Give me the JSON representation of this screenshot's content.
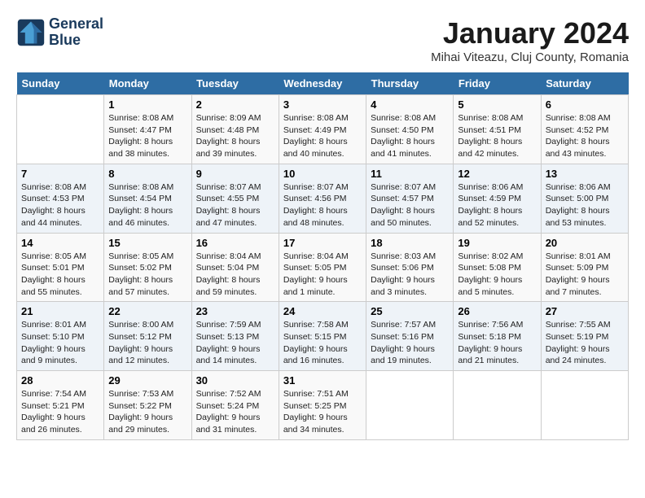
{
  "logo": {
    "line1": "General",
    "line2": "Blue"
  },
  "title": "January 2024",
  "location": "Mihai Viteazu, Cluj County, Romania",
  "weekdays": [
    "Sunday",
    "Monday",
    "Tuesday",
    "Wednesday",
    "Thursday",
    "Friday",
    "Saturday"
  ],
  "weeks": [
    [
      {
        "day": "",
        "info": ""
      },
      {
        "day": "1",
        "info": "Sunrise: 8:08 AM\nSunset: 4:47 PM\nDaylight: 8 hours\nand 38 minutes."
      },
      {
        "day": "2",
        "info": "Sunrise: 8:09 AM\nSunset: 4:48 PM\nDaylight: 8 hours\nand 39 minutes."
      },
      {
        "day": "3",
        "info": "Sunrise: 8:08 AM\nSunset: 4:49 PM\nDaylight: 8 hours\nand 40 minutes."
      },
      {
        "day": "4",
        "info": "Sunrise: 8:08 AM\nSunset: 4:50 PM\nDaylight: 8 hours\nand 41 minutes."
      },
      {
        "day": "5",
        "info": "Sunrise: 8:08 AM\nSunset: 4:51 PM\nDaylight: 8 hours\nand 42 minutes."
      },
      {
        "day": "6",
        "info": "Sunrise: 8:08 AM\nSunset: 4:52 PM\nDaylight: 8 hours\nand 43 minutes."
      }
    ],
    [
      {
        "day": "7",
        "info": "Sunrise: 8:08 AM\nSunset: 4:53 PM\nDaylight: 8 hours\nand 44 minutes."
      },
      {
        "day": "8",
        "info": "Sunrise: 8:08 AM\nSunset: 4:54 PM\nDaylight: 8 hours\nand 46 minutes."
      },
      {
        "day": "9",
        "info": "Sunrise: 8:07 AM\nSunset: 4:55 PM\nDaylight: 8 hours\nand 47 minutes."
      },
      {
        "day": "10",
        "info": "Sunrise: 8:07 AM\nSunset: 4:56 PM\nDaylight: 8 hours\nand 48 minutes."
      },
      {
        "day": "11",
        "info": "Sunrise: 8:07 AM\nSunset: 4:57 PM\nDaylight: 8 hours\nand 50 minutes."
      },
      {
        "day": "12",
        "info": "Sunrise: 8:06 AM\nSunset: 4:59 PM\nDaylight: 8 hours\nand 52 minutes."
      },
      {
        "day": "13",
        "info": "Sunrise: 8:06 AM\nSunset: 5:00 PM\nDaylight: 8 hours\nand 53 minutes."
      }
    ],
    [
      {
        "day": "14",
        "info": "Sunrise: 8:05 AM\nSunset: 5:01 PM\nDaylight: 8 hours\nand 55 minutes."
      },
      {
        "day": "15",
        "info": "Sunrise: 8:05 AM\nSunset: 5:02 PM\nDaylight: 8 hours\nand 57 minutes."
      },
      {
        "day": "16",
        "info": "Sunrise: 8:04 AM\nSunset: 5:04 PM\nDaylight: 8 hours\nand 59 minutes."
      },
      {
        "day": "17",
        "info": "Sunrise: 8:04 AM\nSunset: 5:05 PM\nDaylight: 9 hours\nand 1 minute."
      },
      {
        "day": "18",
        "info": "Sunrise: 8:03 AM\nSunset: 5:06 PM\nDaylight: 9 hours\nand 3 minutes."
      },
      {
        "day": "19",
        "info": "Sunrise: 8:02 AM\nSunset: 5:08 PM\nDaylight: 9 hours\nand 5 minutes."
      },
      {
        "day": "20",
        "info": "Sunrise: 8:01 AM\nSunset: 5:09 PM\nDaylight: 9 hours\nand 7 minutes."
      }
    ],
    [
      {
        "day": "21",
        "info": "Sunrise: 8:01 AM\nSunset: 5:10 PM\nDaylight: 9 hours\nand 9 minutes."
      },
      {
        "day": "22",
        "info": "Sunrise: 8:00 AM\nSunset: 5:12 PM\nDaylight: 9 hours\nand 12 minutes."
      },
      {
        "day": "23",
        "info": "Sunrise: 7:59 AM\nSunset: 5:13 PM\nDaylight: 9 hours\nand 14 minutes."
      },
      {
        "day": "24",
        "info": "Sunrise: 7:58 AM\nSunset: 5:15 PM\nDaylight: 9 hours\nand 16 minutes."
      },
      {
        "day": "25",
        "info": "Sunrise: 7:57 AM\nSunset: 5:16 PM\nDaylight: 9 hours\nand 19 minutes."
      },
      {
        "day": "26",
        "info": "Sunrise: 7:56 AM\nSunset: 5:18 PM\nDaylight: 9 hours\nand 21 minutes."
      },
      {
        "day": "27",
        "info": "Sunrise: 7:55 AM\nSunset: 5:19 PM\nDaylight: 9 hours\nand 24 minutes."
      }
    ],
    [
      {
        "day": "28",
        "info": "Sunrise: 7:54 AM\nSunset: 5:21 PM\nDaylight: 9 hours\nand 26 minutes."
      },
      {
        "day": "29",
        "info": "Sunrise: 7:53 AM\nSunset: 5:22 PM\nDaylight: 9 hours\nand 29 minutes."
      },
      {
        "day": "30",
        "info": "Sunrise: 7:52 AM\nSunset: 5:24 PM\nDaylight: 9 hours\nand 31 minutes."
      },
      {
        "day": "31",
        "info": "Sunrise: 7:51 AM\nSunset: 5:25 PM\nDaylight: 9 hours\nand 34 minutes."
      },
      {
        "day": "",
        "info": ""
      },
      {
        "day": "",
        "info": ""
      },
      {
        "day": "",
        "info": ""
      }
    ]
  ]
}
